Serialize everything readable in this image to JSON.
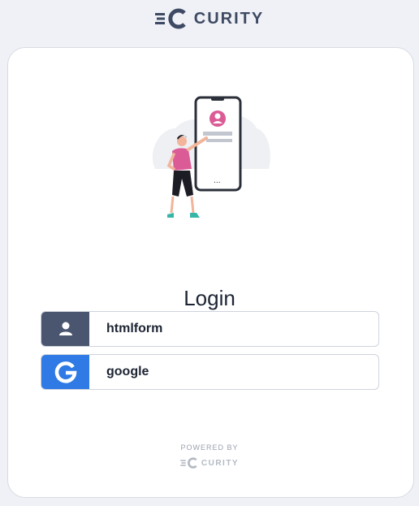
{
  "brand": {
    "name": "CURITY"
  },
  "login": {
    "title": "Login",
    "providers": [
      {
        "label": "htmlform",
        "icon": "user-icon",
        "color": "#4a5670"
      },
      {
        "label": "google",
        "icon": "google-icon",
        "color": "#2f7ae5"
      }
    ]
  },
  "footer": {
    "powered_by": "POWERED BY",
    "brand": "CURITY"
  },
  "colors": {
    "background": "#eff1f6",
    "card": "#ffffff",
    "accent": "#db5b96"
  }
}
